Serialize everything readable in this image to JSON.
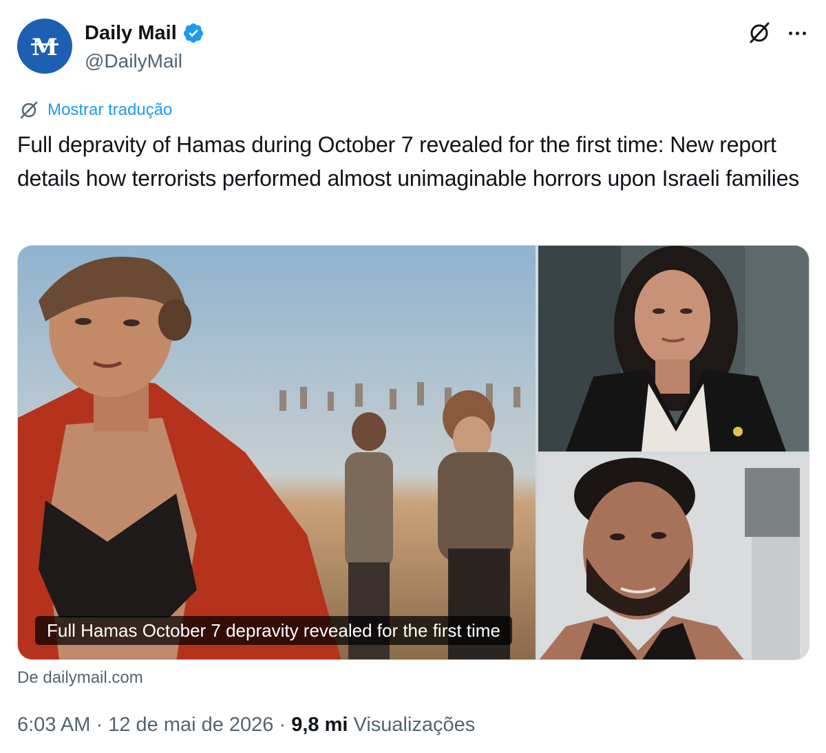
{
  "author": {
    "name": "Daily Mail",
    "handle": "@DailyMail",
    "avatar_letters": "M",
    "verified": true,
    "colors": {
      "avatar_bg": "#1d5fb0",
      "verified": "#1d9bf0"
    }
  },
  "icons": {
    "grok": "grok-icon",
    "more": "more-icon",
    "translate": "translate-icon",
    "verified": "verified-badge-icon"
  },
  "translate": {
    "label": "Mostrar tradução"
  },
  "tweet": {
    "text": "Full depravity of Hamas during October 7 revealed for the first time: New report details how terrorists performed almost unimaginable horrors upon Israeli families"
  },
  "media": {
    "caption": "Full Hamas October 7 depravity revealed for the first time",
    "source": "De dailymail.com"
  },
  "meta": {
    "time": "6:03 AM",
    "sep1": " · ",
    "date": "12 de mai de 2026",
    "sep2": " · ",
    "views_count": "9,8 mi",
    "views_label": " Visualizações"
  }
}
